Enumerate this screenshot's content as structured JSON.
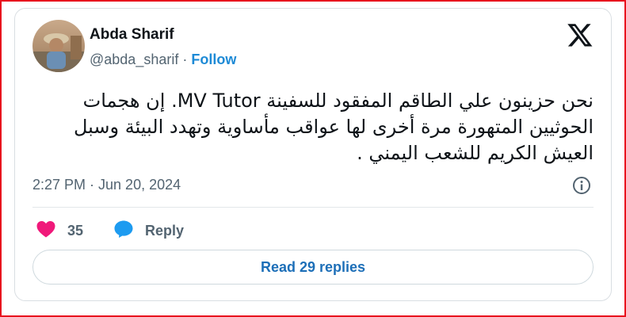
{
  "tweet": {
    "author_name": "Abda Sharif",
    "handle": "@abda_sharif",
    "separator": "·",
    "follow_label": "Follow",
    "text": "نحن حزينون علي  الطاقم المفقود للسفينة  MV Tutor. إن هجمات الحوثيين المتهورة مرة أخرى لها عواقب مأساوية وتهدد البيئة وسبل العيش الكريم للشعب اليمني .",
    "timestamp": "2:27 PM · Jun 20, 2024",
    "likes": "35",
    "reply_label": "Reply",
    "read_replies_label": "Read 29 replies"
  },
  "icons": {
    "logo": "x-logo-icon",
    "info": "info-icon",
    "like": "heart-icon",
    "reply": "speech-bubble-icon"
  },
  "colors": {
    "frame": "#e8121e",
    "follow": "#1d8ad6",
    "heart": "#f0197a",
    "reply_bubble": "#1d9bf0",
    "button_text": "#1d6fb8"
  }
}
